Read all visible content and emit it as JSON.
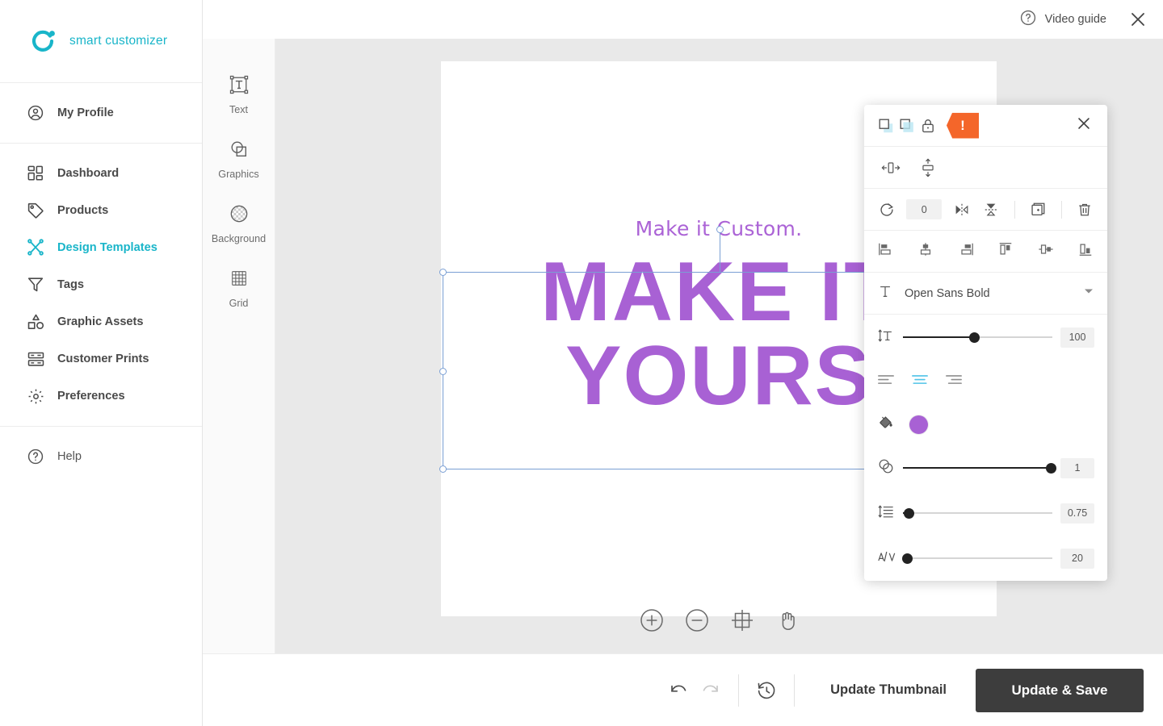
{
  "brand": {
    "name": "smart customizer",
    "color": "#19b5c9",
    "logo_icon": "ring-dot-logo-icon"
  },
  "sidebar": {
    "profile": {
      "label": "My Profile",
      "icon": "user-circle-icon"
    },
    "items": [
      {
        "label": "Dashboard",
        "icon": "dashboard-grid-icon",
        "active": false
      },
      {
        "label": "Products",
        "icon": "tag-icon",
        "active": false
      },
      {
        "label": "Design Templates",
        "icon": "scissors-design-icon",
        "active": true
      },
      {
        "label": "Tags",
        "icon": "funnel-icon",
        "active": false
      },
      {
        "label": "Graphic Assets",
        "icon": "shapes-icon",
        "active": false
      },
      {
        "label": "Customer Prints",
        "icon": "prints-icon",
        "active": false
      },
      {
        "label": "Preferences",
        "icon": "gear-icon",
        "active": false
      }
    ],
    "help": {
      "label": "Help",
      "icon": "question-circle-icon"
    }
  },
  "topbar": {
    "video_guide": "Video guide",
    "video_guide_icon": "question-circle-icon",
    "close_icon": "close-icon"
  },
  "toolrail": [
    {
      "label": "Text",
      "icon": "text-box-icon"
    },
    {
      "label": "Graphics",
      "icon": "shapes-overlap-icon"
    },
    {
      "label": "Background",
      "icon": "checker-circle-icon"
    },
    {
      "label": "Grid",
      "icon": "grid-icon"
    }
  ],
  "canvas": {
    "background_color": "#e9e9e9",
    "artboard_color": "#ffffff",
    "subtitle_text": "Make it Custom.",
    "headline_line1": "MAKE IT",
    "headline_line2": "YOURS",
    "text_color": "#a861d4",
    "selection_color": "#7a9fd4"
  },
  "zoom_tools": [
    {
      "name": "zoom-in",
      "icon": "plus-circle-icon"
    },
    {
      "name": "zoom-out",
      "icon": "minus-circle-icon"
    },
    {
      "name": "fit-to-view",
      "icon": "crosshair-frame-icon"
    },
    {
      "name": "pan",
      "icon": "hand-icon"
    }
  ],
  "properties_panel": {
    "layer_controls": [
      {
        "name": "bring-to-front",
        "icon": "bring-to-front-icon"
      },
      {
        "name": "send-to-back",
        "icon": "send-to-back-icon"
      },
      {
        "name": "lock",
        "icon": "lock-icon"
      }
    ],
    "warning_badge": {
      "label": "!",
      "color": "#f4662a",
      "icon": "warning-tag-icon"
    },
    "close_icon": "close-icon",
    "size_controls": [
      {
        "name": "fit-width",
        "icon": "fit-width-icon"
      },
      {
        "name": "fit-height",
        "icon": "fit-height-icon"
      }
    ],
    "rotation": {
      "icon": "rotate-icon",
      "value": "0"
    },
    "transform_controls": [
      {
        "name": "flip-horizontal",
        "icon": "flip-horizontal-icon"
      },
      {
        "name": "flip-vertical",
        "icon": "flip-vertical-icon"
      },
      {
        "name": "duplicate",
        "icon": "duplicate-icon"
      },
      {
        "name": "delete",
        "icon": "trash-icon"
      }
    ],
    "alignment": [
      {
        "name": "align-left",
        "icon": "align-left-icon"
      },
      {
        "name": "align-center-h",
        "icon": "align-center-horizontal-icon"
      },
      {
        "name": "align-right",
        "icon": "align-right-icon"
      },
      {
        "name": "align-top",
        "icon": "align-top-icon"
      },
      {
        "name": "align-middle-v",
        "icon": "align-middle-vertical-icon"
      },
      {
        "name": "align-bottom",
        "icon": "align-bottom-icon"
      }
    ],
    "font": {
      "icon": "font-type-icon",
      "name": "Open Sans Bold",
      "caret_icon": "chevron-down-icon"
    },
    "font_size": {
      "icon": "font-size-icon",
      "value": "100",
      "percent": 48
    },
    "text_align": {
      "options": [
        {
          "name": "text-align-left",
          "icon": "text-align-left-icon",
          "active": false
        },
        {
          "name": "text-align-center",
          "icon": "text-align-center-icon",
          "active": true
        },
        {
          "name": "text-align-right",
          "icon": "text-align-right-icon",
          "active": false
        }
      ],
      "active_color": "#4fc3e8"
    },
    "fill": {
      "icon": "paint-bucket-icon",
      "color": "#a861d4"
    },
    "opacity": {
      "icon": "opacity-circles-icon",
      "value": "1",
      "percent": 99
    },
    "line_height": {
      "icon": "line-height-icon",
      "value": "0.75",
      "percent": 4
    },
    "letter_spacing": {
      "icon": "letter-spacing-icon",
      "value": "20",
      "percent": 2
    }
  },
  "footer": {
    "undo": {
      "name": "undo",
      "icon": "undo-icon",
      "disabled": false
    },
    "redo": {
      "name": "redo",
      "icon": "redo-icon",
      "disabled": true
    },
    "history": {
      "name": "history",
      "icon": "history-clock-icon"
    },
    "update_thumbnail_label": "Update Thumbnail",
    "save_label": "Update & Save",
    "save_color": "#3d3d3d"
  }
}
